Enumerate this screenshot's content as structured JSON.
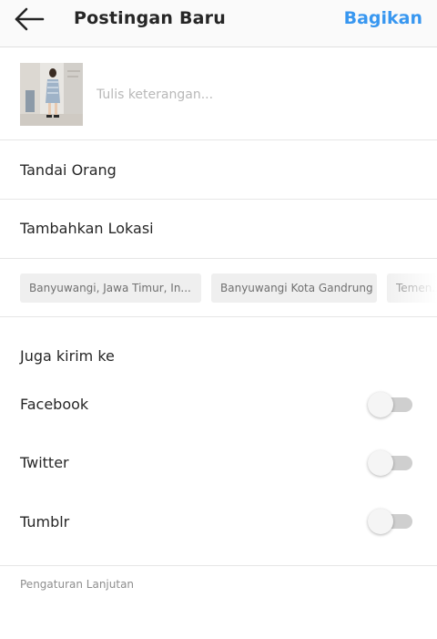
{
  "header": {
    "title": "Postingan Baru",
    "share_label": "Bagikan",
    "accent_color": "#3897f0"
  },
  "icons": {
    "back": "arrow-left-icon"
  },
  "caption": {
    "placeholder": "Tulis keterangan...",
    "value": ""
  },
  "tag_people": {
    "label": "Tandai Orang"
  },
  "add_location": {
    "label": "Tambahkan Lokasi"
  },
  "location_suggestions": [
    "Banyuwangi, Jawa Timur, In...",
    "Banyuwangi Kota Gandrung",
    "Temen..."
  ],
  "share_to": {
    "title": "Juga kirim ke",
    "items": [
      {
        "label": "Facebook",
        "enabled": false
      },
      {
        "label": "Twitter",
        "enabled": false
      },
      {
        "label": "Tumblr",
        "enabled": false
      }
    ]
  },
  "advanced_settings": {
    "label": "Pengaturan Lanjutan"
  }
}
